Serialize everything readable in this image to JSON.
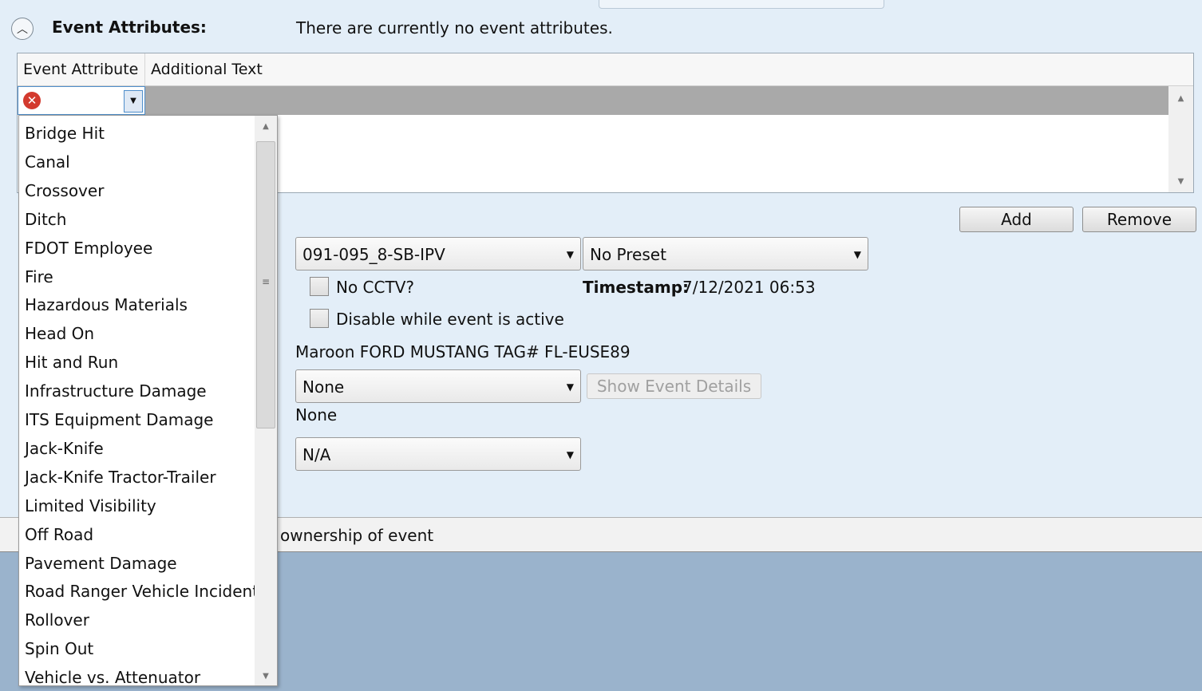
{
  "section": {
    "title": "Event Attributes:",
    "message": "There are currently no event attributes."
  },
  "grid": {
    "columns": [
      "Event Attribute",
      "Additional Text"
    ]
  },
  "buttons": {
    "add": "Add",
    "remove": "Remove",
    "show_event_details": "Show Event Details"
  },
  "camera": {
    "selected": "091-095_8-SB-IPV",
    "preset": "No Preset",
    "no_cctv_label": "No CCTV?",
    "disable_label": "Disable while event is active",
    "timestamp_label": "Timestamp:",
    "timestamp_value": "7/12/2021 06:53"
  },
  "vehicle_description": "Maroon FORD MUSTANG TAG# FL-EUSE89",
  "related_event": {
    "selected": "None",
    "value_text": "None"
  },
  "condition_select": "N/A",
  "footer": {
    "text": "ownership of event"
  },
  "dropdown": {
    "items": [
      "Bridge Hit",
      "Canal",
      "Crossover",
      "Ditch",
      "FDOT Employee",
      "Fire",
      "Hazardous Materials",
      "Head On",
      "Hit and Run",
      "Infrastructure Damage",
      "ITS Equipment Damage",
      "Jack-Knife",
      "Jack-Knife Tractor-Trailer",
      "Limited Visibility",
      "Off Road",
      "Pavement Damage",
      "Road Ranger Vehicle Incident",
      "Rollover",
      "Spin Out",
      "Vehicle vs. Attenuator"
    ]
  }
}
